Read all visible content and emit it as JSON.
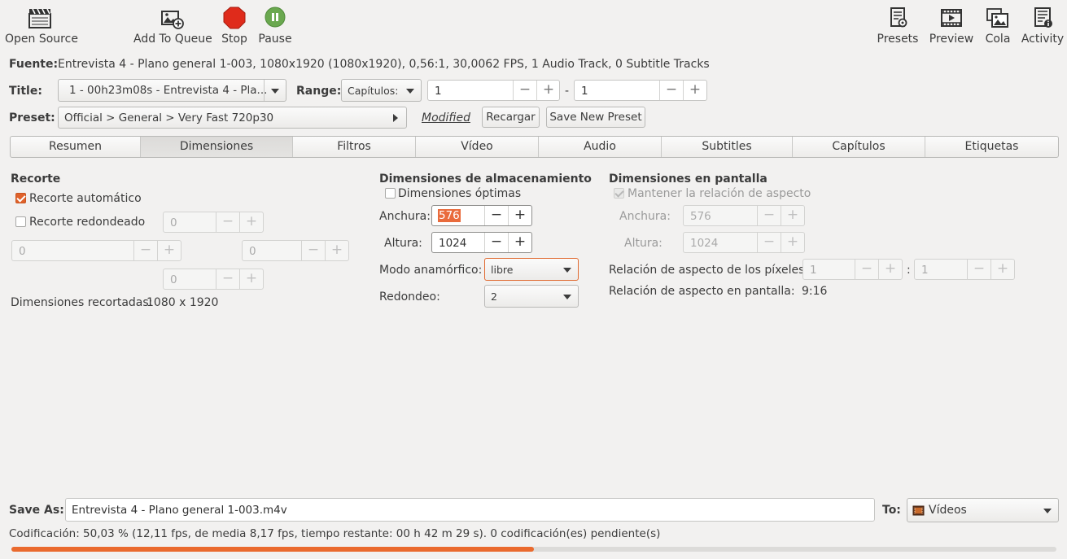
{
  "toolbar": {
    "open_source": "Open Source",
    "add_to_queue": "Add To Queue",
    "stop": "Stop",
    "pause": "Pause",
    "presets": "Presets",
    "preview": "Preview",
    "cola": "Cola",
    "activity": "Activity"
  },
  "source": {
    "label": "Fuente:",
    "value": "Entrevista 4 - Plano general 1-003, 1080x1920 (1080x1920), 0,56:1, 30,0062 FPS, 1 Audio Track, 0 Subtitle Tracks"
  },
  "title_row": {
    "title_label": "Title:",
    "title_value": "1 - 00h23m08s - Entrevista 4 - Pla...",
    "range_label": "Range:",
    "range_mode": "Capítulos:",
    "range_start": "1",
    "range_sep": "-",
    "range_end": "1"
  },
  "preset_row": {
    "label": "Preset:",
    "value": "Official > General > Very Fast 720p30",
    "modified": "Modified",
    "reload": "Recargar",
    "save_new": "Save New Preset"
  },
  "tabs": [
    "Resumen",
    "Dimensiones",
    "Filtros",
    "Vídeo",
    "Audio",
    "Subtitles",
    "Capítulos",
    "Etiquetas"
  ],
  "active_tab": "Dimensiones",
  "crop": {
    "heading": "Recorte",
    "auto_label": "Recorte automático",
    "auto_checked": true,
    "round_label": "Recorte redondeado",
    "round_checked": false,
    "top": "0",
    "left": "0",
    "right": "0",
    "bottom": "0",
    "cropped_label": "Dimensiones recortadas:",
    "cropped_value": "1080 x 1920"
  },
  "storage": {
    "heading": "Dimensiones de almacenamiento",
    "optimal_label": "Dimensiones óptimas",
    "optimal_checked": false,
    "width_label": "Anchura:",
    "width_value": "576",
    "height_label": "Altura:",
    "height_value": "1024",
    "anamorphic_label": "Modo anamórfico:",
    "anamorphic_value": "libre",
    "rounding_label": "Redondeo:",
    "rounding_value": "2"
  },
  "display": {
    "heading": "Dimensiones en pantalla",
    "keep_aspect_label": "Mantener la relación de aspecto",
    "keep_aspect_checked": true,
    "width_label": "Anchura:",
    "width_value": "576",
    "height_label": "Altura:",
    "height_value": "1024",
    "par_label": "Relación de aspecto de los píxeles:",
    "par_num": "1",
    "par_sep": ":",
    "par_den": "1",
    "dar_label": "Relación de aspecto en pantalla:",
    "dar_value": "9:16"
  },
  "save": {
    "label": "Save As:",
    "filename": "Entrevista 4 - Plano general 1-003.m4v",
    "to_label": "To:",
    "destination": "Vídeos"
  },
  "status": {
    "text": "Codificación: 50,03 % (12,11 fps, de media 8,17 fps, tiempo restante: 00 h 42 m 29 s). 0 codificación(es) pendiente(s)",
    "progress": 0.5003
  },
  "colors": {
    "accent": "#e95420",
    "stop": "#df2b1b",
    "pause": "#6aa84f",
    "progress": "#ea6a2e"
  }
}
